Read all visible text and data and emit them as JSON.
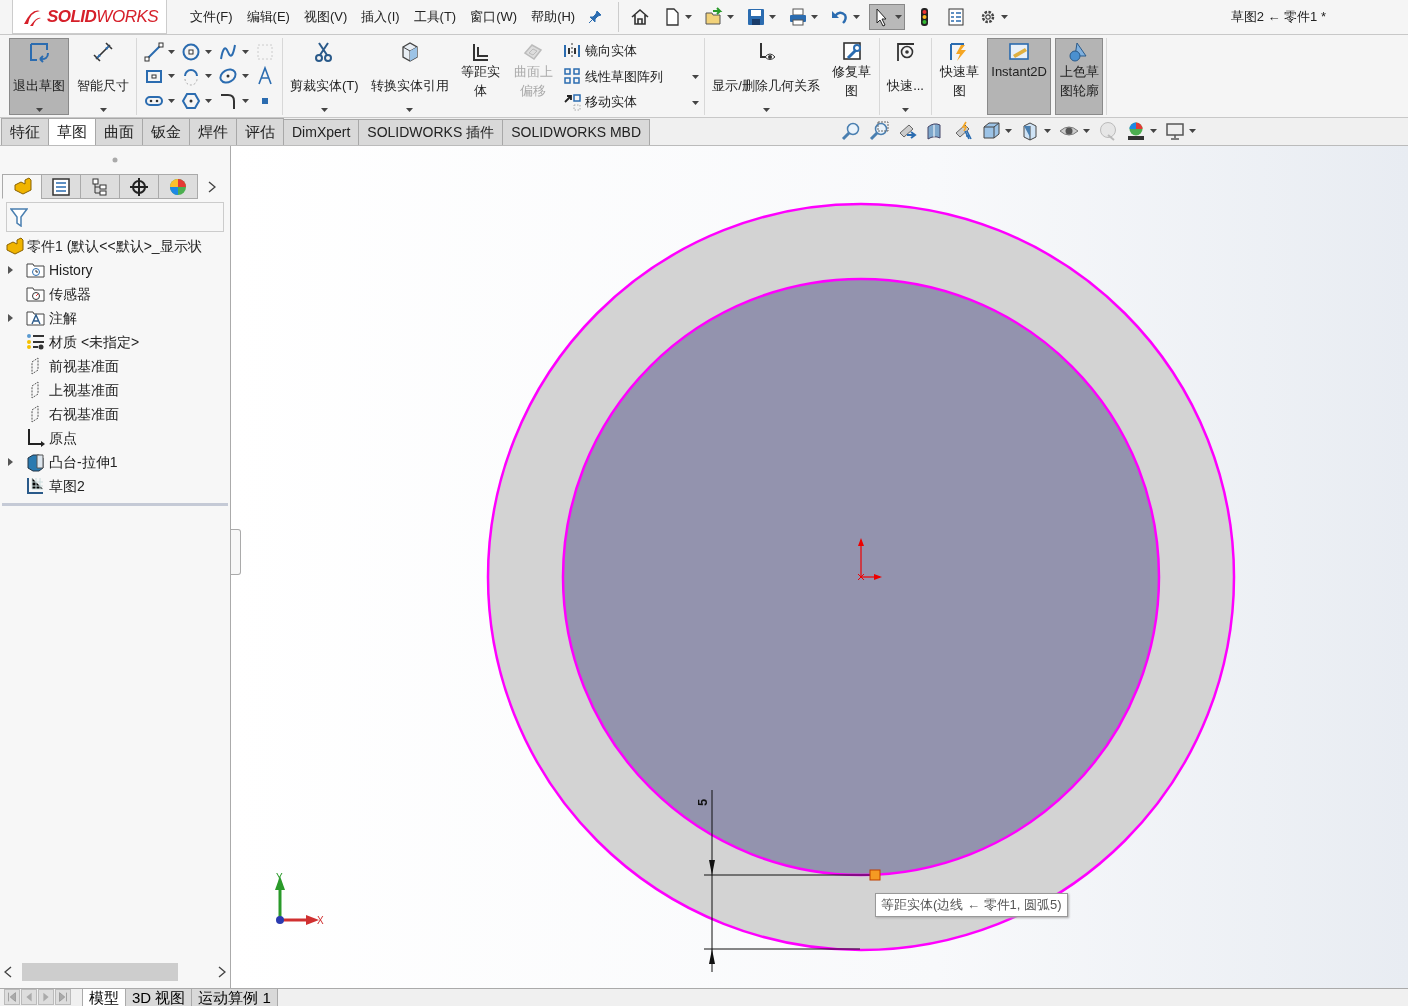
{
  "app": {
    "logo": "**SOLID**WORKS",
    "title": "草图2 ← 零件1 *"
  },
  "menu": [
    "文件(F)",
    "编辑(E)",
    "视图(V)",
    "插入(I)",
    "工具(T)",
    "窗口(W)",
    "帮助(H)"
  ],
  "quick_toolbar": [
    {
      "selected": false,
      "dropdown": false
    },
    {
      "selected": false,
      "dropdown": true
    },
    {
      "selected": false,
      "dropdown": true
    },
    {
      "selected": false,
      "dropdown": true
    },
    {
      "selected": false,
      "dropdown": true
    },
    {
      "selected": false,
      "dropdown": true
    },
    {
      "selected": true,
      "dropdown": true
    },
    {
      "selected": false,
      "dropdown": false
    },
    {
      "selected": false,
      "dropdown": false
    },
    {
      "selected": false,
      "dropdown": true
    }
  ],
  "ribbon": [
    {
      "kind": "commands",
      "items": [
        {
          "kind": "large",
          "label": "退出草图",
          "selected": true,
          "disabled": false,
          "dropdown": true
        },
        {
          "kind": "large",
          "label": "智能尺寸",
          "selected": false,
          "disabled": false,
          "dropdown": true
        }
      ]
    },
    {
      "kind": "sketch-tools"
    },
    {
      "kind": "commands",
      "items": [
        {
          "kind": "large",
          "label": "剪裁实体(T)",
          "selected": false,
          "disabled": false,
          "dropdown": true
        },
        {
          "kind": "large",
          "label": "转换实体引用",
          "selected": false,
          "disabled": false,
          "dropdown": true
        },
        {
          "kind": "tall",
          "label": "等距实体",
          "selected": false,
          "disabled": false,
          "dropdown": false
        },
        {
          "kind": "tall",
          "label": "曲面上偏移",
          "selected": false,
          "disabled": true,
          "dropdown": false
        },
        {
          "kind": "stack",
          "items": [
            {
              "label": "镜向实体",
              "dropdown": false
            },
            {
              "label": "线性草图阵列",
              "dropdown": true
            },
            {
              "label": "移动实体",
              "dropdown": true
            }
          ]
        }
      ]
    },
    {
      "kind": "commands",
      "items": [
        {
          "kind": "large",
          "label": "显示/删除几何关系",
          "selected": false,
          "disabled": false,
          "dropdown": true
        },
        {
          "kind": "tall",
          "label": "修复草图",
          "selected": false,
          "disabled": false,
          "dropdown": false
        }
      ]
    },
    {
      "kind": "commands",
      "items": [
        {
          "kind": "large",
          "label": "快速...",
          "selected": false,
          "disabled": false,
          "dropdown": true
        }
      ]
    },
    {
      "kind": "commands",
      "items": [
        {
          "kind": "tall",
          "label": "快速草图",
          "selected": false,
          "disabled": false,
          "dropdown": false
        },
        {
          "kind": "tall",
          "label": "Instant2D",
          "selected": true,
          "disabled": false,
          "dropdown": false
        },
        {
          "kind": "tall",
          "label": "上色草图轮廓",
          "selected": true,
          "disabled": false,
          "dropdown": false
        }
      ]
    }
  ],
  "command_tabs": [
    {
      "label": "特征",
      "selected": false
    },
    {
      "label": "草图",
      "selected": true
    },
    {
      "label": "曲面",
      "selected": false
    },
    {
      "label": "钣金",
      "selected": false
    },
    {
      "label": "焊件",
      "selected": false
    },
    {
      "label": "评估",
      "selected": false
    },
    {
      "label": "DimXpert",
      "selected": false
    },
    {
      "label": "SOLIDWORKS 插件",
      "selected": false
    },
    {
      "label": "SOLIDWORKS MBD",
      "selected": false
    }
  ],
  "feature_manager": {
    "tabs": [
      {
        "selected": true
      },
      {
        "selected": false
      },
      {
        "selected": false
      },
      {
        "selected": false
      },
      {
        "selected": false
      }
    ],
    "tree": {
      "label": "零件1  (默认<<默认>_显示状",
      "children": [
        {
          "label": "History",
          "expandable": true
        },
        {
          "label": "传感器",
          "expandable": false
        },
        {
          "label": "注解",
          "expandable": true
        },
        {
          "label": "材质 <未指定>",
          "expandable": false
        },
        {
          "label": "前视基准面",
          "expandable": false
        },
        {
          "label": "上视基准面",
          "expandable": false
        },
        {
          "label": "右视基准面",
          "expandable": false
        },
        {
          "label": "原点",
          "expandable": false
        },
        {
          "label": "凸台-拉伸1",
          "expandable": true
        },
        {
          "label": "草图2",
          "expandable": false
        }
      ]
    }
  },
  "graphics": {
    "dimension": "5",
    "tooltip": "等距实体(边线 ← 零件1, 圆弧5)",
    "triad": {
      "y": "Y",
      "x": "X"
    }
  },
  "bottom_tabs": [
    {
      "label": "模型",
      "selected": true
    },
    {
      "label": "3D 视图",
      "selected": false
    },
    {
      "label": "运动算例 1",
      "selected": false
    }
  ]
}
